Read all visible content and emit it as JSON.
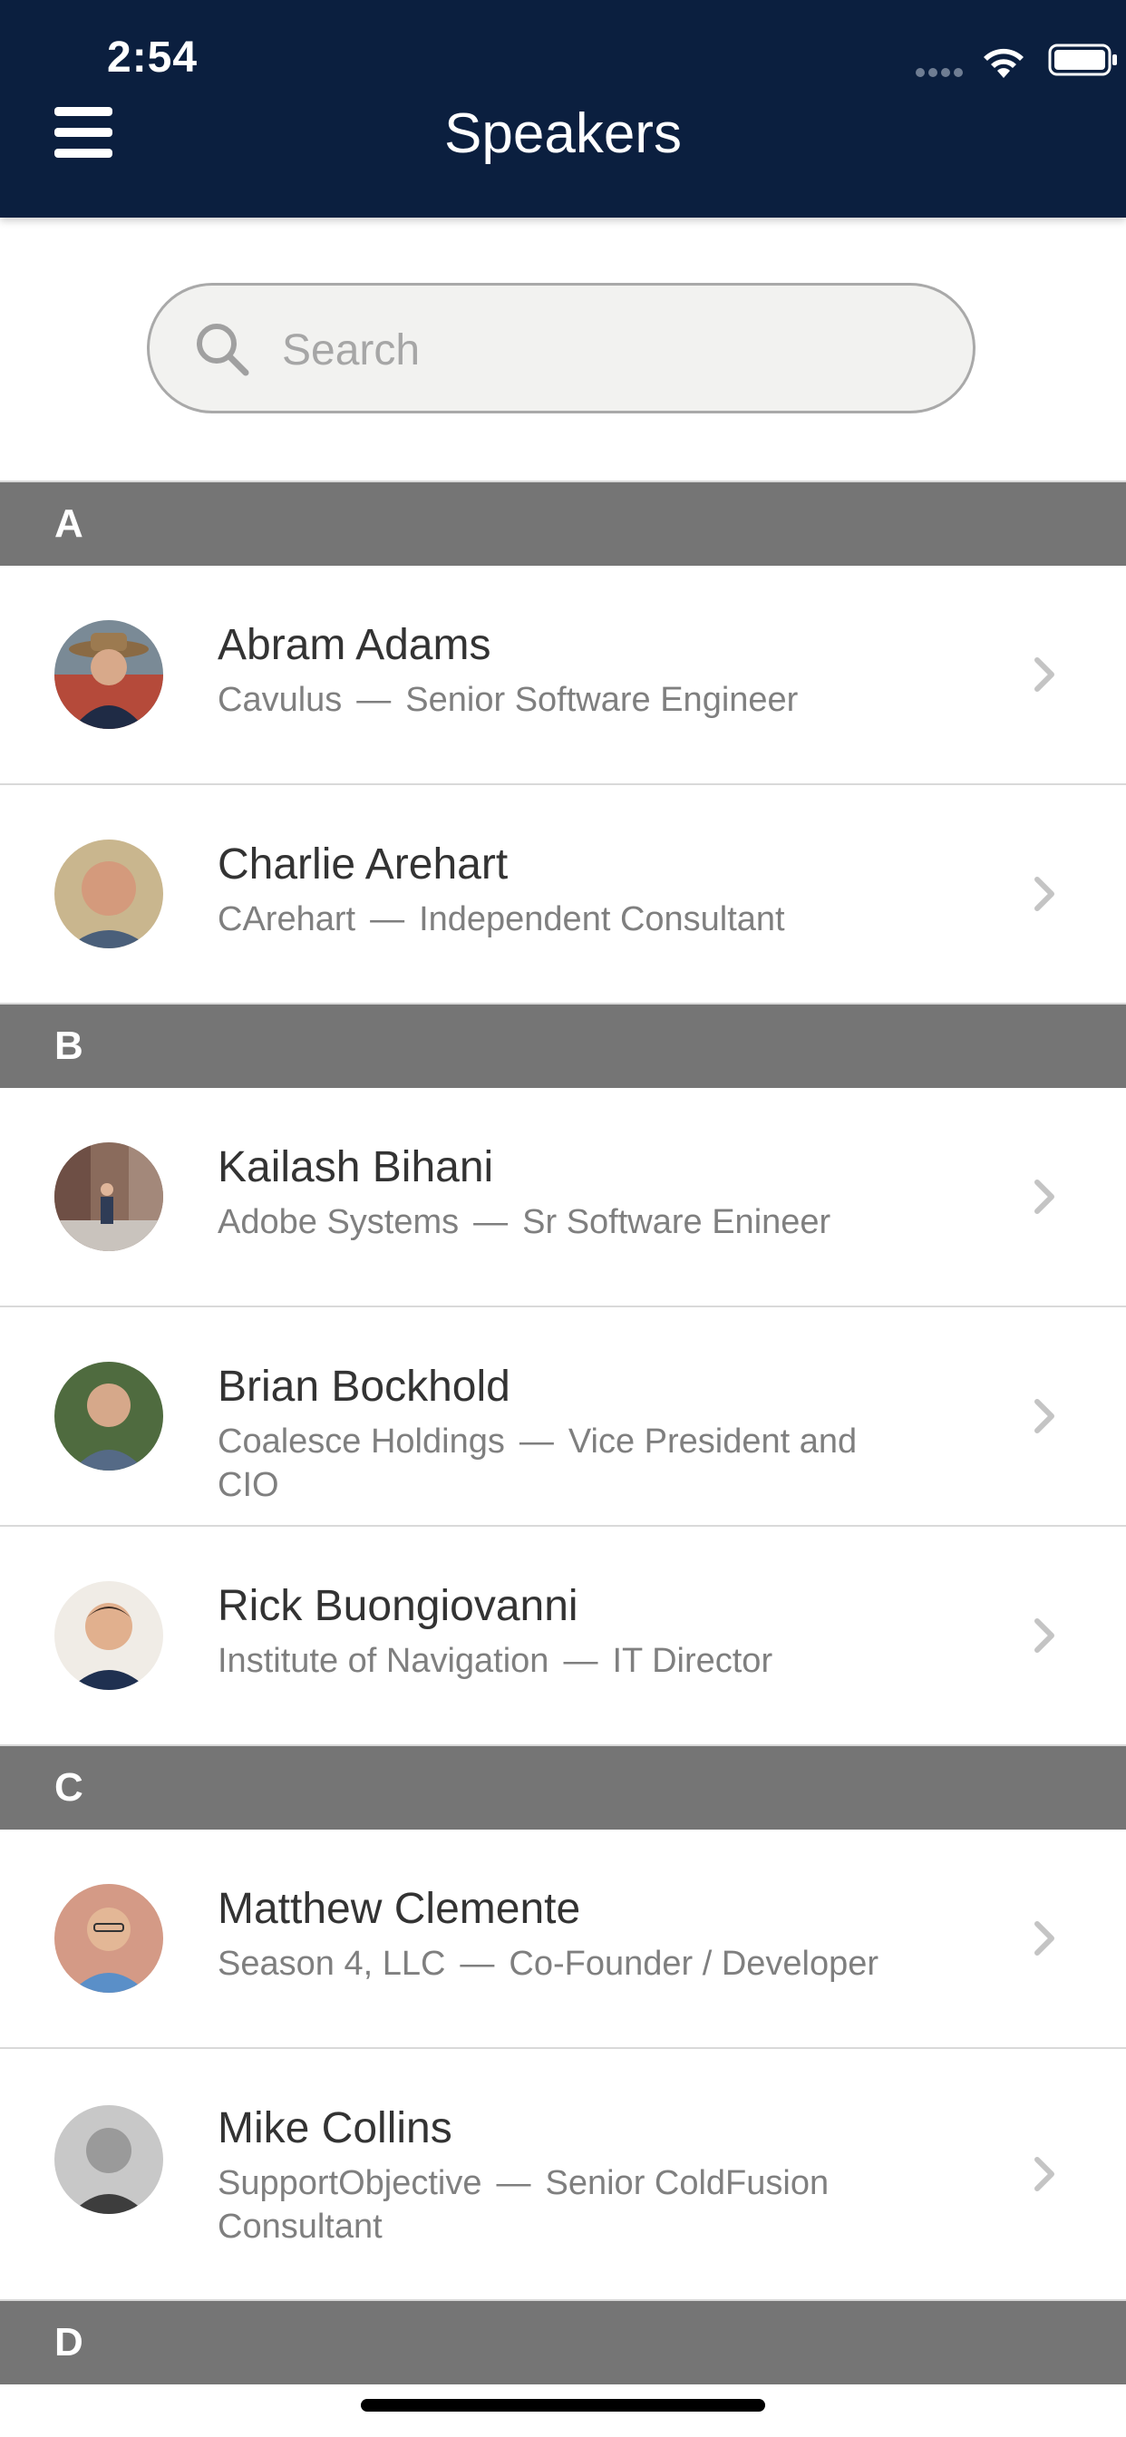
{
  "status_bar": {
    "time": "2:54"
  },
  "header": {
    "title": "Speakers",
    "menu_icon": "hamburger-menu-icon"
  },
  "search": {
    "placeholder": "Search",
    "value": "",
    "icon": "search-icon"
  },
  "sections": [
    {
      "letter": "A",
      "speakers": [
        {
          "name": "Abram Adams",
          "company": "Cavulus",
          "dash": "—",
          "title": "Senior Software Engineer"
        },
        {
          "name": "Charlie Arehart",
          "company": "CArehart",
          "dash": "—",
          "title": "Independent Consultant"
        }
      ]
    },
    {
      "letter": "B",
      "speakers": [
        {
          "name": "Kailash Bihani",
          "company": "Adobe Systems",
          "dash": "—",
          "title": "Sr Software Enineer"
        },
        {
          "name": "Brian Bockhold",
          "company": "Coalesce Holdings",
          "dash": "—",
          "title": "Vice President and CIO"
        },
        {
          "name": "Rick Buongiovanni",
          "company": "Institute of Navigation",
          "dash": "—",
          "title": "IT Director"
        }
      ]
    },
    {
      "letter": "C",
      "speakers": [
        {
          "name": "Matthew Clemente",
          "company": "Season 4, LLC",
          "dash": "—",
          "title": "Co-Founder / Developer"
        },
        {
          "name": "Mike Collins",
          "company": "SupportObjective",
          "dash": "—",
          "title": "Senior ColdFusion Consultant"
        }
      ]
    },
    {
      "letter": "D",
      "speakers": []
    }
  ],
  "colors": {
    "header_bg": "#0b1f3f",
    "section_bg": "#757575",
    "name_text": "#333333",
    "sub_text": "#7f7f7f"
  }
}
